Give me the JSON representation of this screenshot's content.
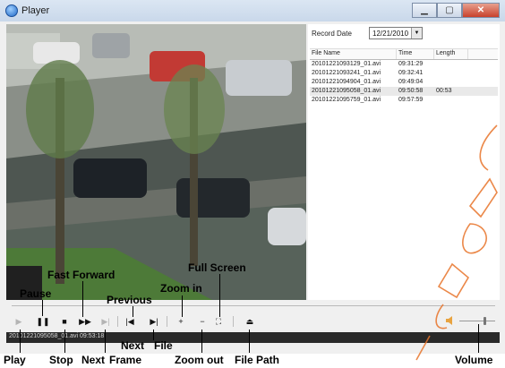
{
  "window": {
    "title": "Player",
    "controls": [
      "minimize",
      "maximize",
      "close"
    ]
  },
  "video": {
    "scene": "parking lot camera view"
  },
  "sidebar": {
    "record_date_label": "Record Date",
    "record_date_value": "12/21/2010",
    "table": {
      "headers": [
        "File Name",
        "Time",
        "Length"
      ],
      "rows": [
        {
          "file": "20101221093129_01.avi",
          "time": "09:31:29",
          "length": "",
          "selected": false
        },
        {
          "file": "20101221093241_01.avi",
          "time": "09:32:41",
          "length": "",
          "selected": false
        },
        {
          "file": "20101221094904_01.avi",
          "time": "09:49:04",
          "length": "",
          "selected": false
        },
        {
          "file": "20101221095058_01.avi",
          "time": "09:50:58",
          "length": "00:53",
          "selected": true
        },
        {
          "file": "20101221095759_01.avi",
          "time": "09:57:59",
          "length": "",
          "selected": false
        }
      ]
    }
  },
  "controls": {
    "buttons": [
      {
        "name": "play-button",
        "icon": "play-icon",
        "glyph": "▶",
        "enabled": false
      },
      {
        "name": "pause-button",
        "icon": "pause-icon",
        "glyph": "❚❚",
        "enabled": true
      },
      {
        "name": "stop-button",
        "icon": "stop-icon",
        "glyph": "■",
        "enabled": true
      },
      {
        "name": "fast-forward-button",
        "icon": "fast-forward-icon",
        "glyph": "▶▶",
        "enabled": true
      },
      {
        "name": "next-frame-button",
        "icon": "next-frame-icon",
        "glyph": "▶|",
        "enabled": false
      },
      {
        "name": "previous-file-button",
        "icon": "previous-file-icon",
        "glyph": "|◀",
        "enabled": true
      },
      {
        "name": "next-file-button",
        "icon": "next-file-icon",
        "glyph": "▶|",
        "enabled": true
      },
      {
        "name": "zoom-in-button",
        "icon": "plus-icon",
        "glyph": "+",
        "enabled": true
      },
      {
        "name": "zoom-out-button",
        "icon": "minus-icon",
        "glyph": "−",
        "enabled": true
      },
      {
        "name": "full-screen-button",
        "icon": "full-screen-icon",
        "glyph": "⛶",
        "enabled": true
      },
      {
        "name": "file-path-button",
        "icon": "eject-icon",
        "glyph": "⏏",
        "enabled": true
      }
    ],
    "volume_level": 0.7
  },
  "status": {
    "file": "20101221095058_01.avi",
    "time": "09:53:18"
  },
  "annotations": {
    "play": "Play",
    "pause": "Pause",
    "stop": "Stop",
    "fast_forward": "Fast Forward",
    "next_frame_1": "Next",
    "next_frame_2": "Frame",
    "previous": "Previous",
    "next_file_1": "Next",
    "next_file_2": "File",
    "zoom_in": "Zoom in",
    "zoom_out": "Zoom out",
    "full_screen": "Full Screen",
    "file_path": "File Path",
    "volume": "Volume"
  },
  "colors": {
    "titlebar": "#c9d8ea",
    "close": "#c8412c",
    "status_bar": "#2a2a2a",
    "watermark": "#e8742a"
  }
}
